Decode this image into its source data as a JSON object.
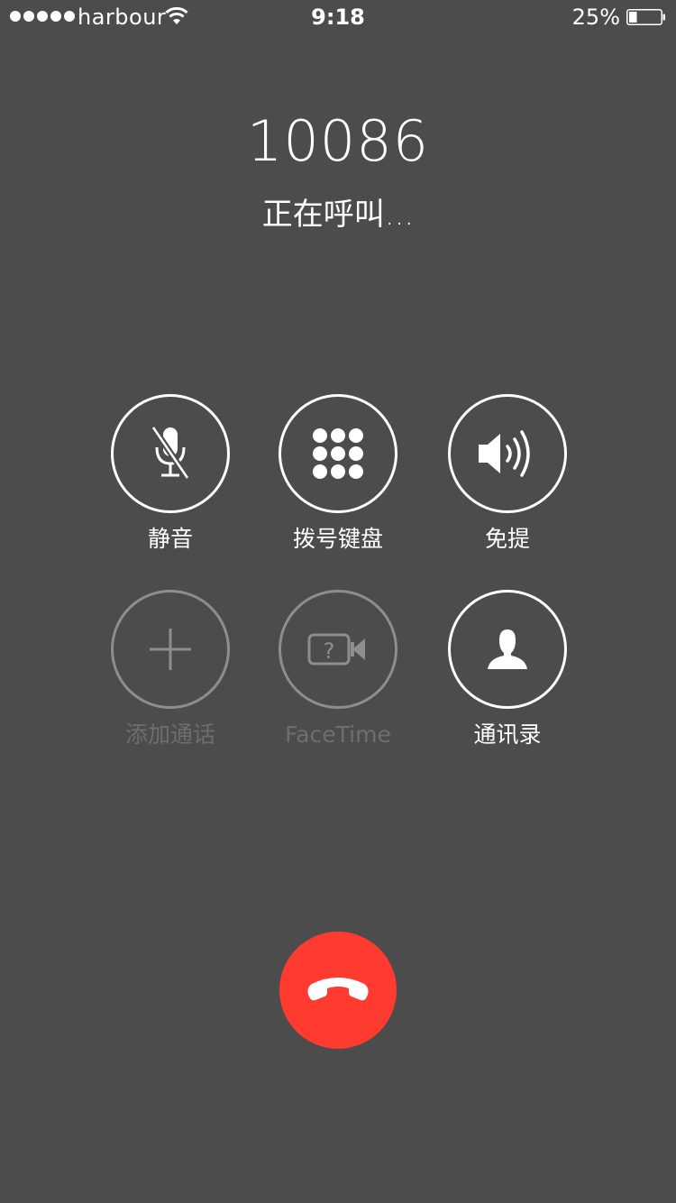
{
  "status_bar": {
    "carrier": "harbour",
    "time": "9:18",
    "battery_percent": "25%",
    "battery_level": 0.25,
    "signal_bars": 5,
    "wifi_icon": "wifi-icon"
  },
  "call": {
    "number": "10086",
    "status": "正在呼叫..."
  },
  "controls": {
    "mute": {
      "label": "静音",
      "icon": "mute-microphone-icon",
      "enabled": true
    },
    "keypad": {
      "label": "拨号键盘",
      "icon": "keypad-icon",
      "enabled": true
    },
    "speaker": {
      "label": "免提",
      "icon": "speaker-icon",
      "enabled": true
    },
    "add_call": {
      "label": "添加通话",
      "icon": "plus-icon",
      "enabled": false
    },
    "facetime": {
      "label": "FaceTime",
      "icon": "facetime-camera-icon",
      "enabled": false
    },
    "contacts": {
      "label": "通讯录",
      "icon": "contact-person-icon",
      "enabled": true
    }
  },
  "end_call": {
    "icon": "end-call-icon"
  },
  "colors": {
    "background": "#4c4c4c",
    "end_call": "#ff3b30",
    "foreground": "#ffffff",
    "disabled_ring": "#8e8e8e",
    "disabled_label": "#6e6e6e"
  }
}
